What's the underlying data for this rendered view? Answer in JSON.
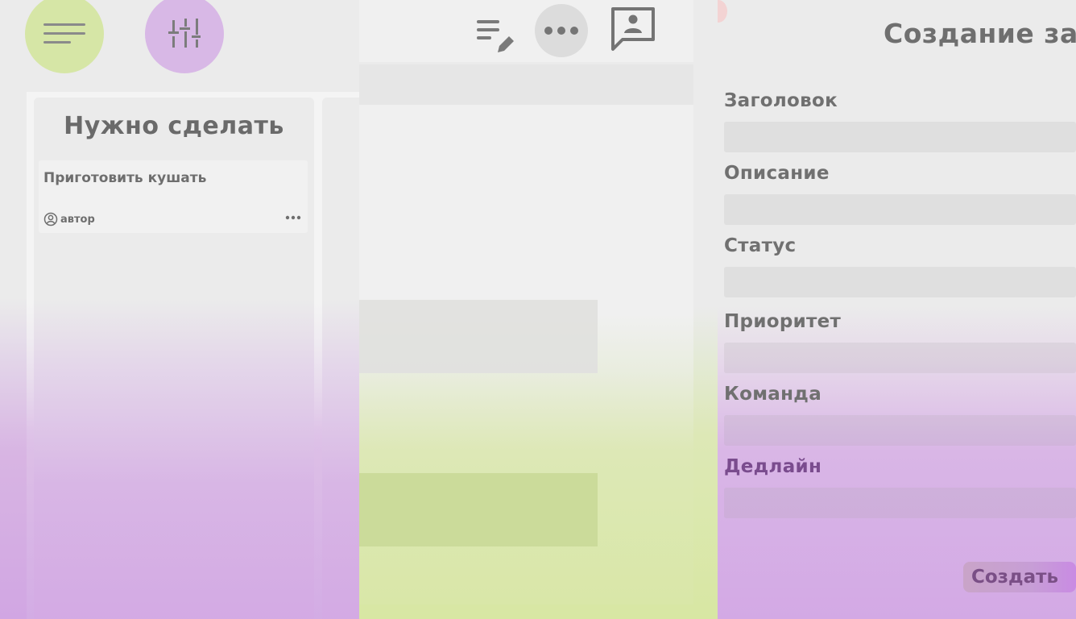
{
  "left": {
    "menu_icon": "hamburger-icon",
    "filter_icon": "sliders-icon",
    "columns": [
      {
        "title": "Нужно сделать",
        "tasks": [
          {
            "title": "Приготовить кушать",
            "author": "автор",
            "author_icon": "user-circle-icon",
            "more_icon": "more-horizontal-icon"
          }
        ]
      }
    ]
  },
  "middle": {
    "icons": [
      "edit-list-icon",
      "more-horizontal-icon",
      "chat-user-icon"
    ]
  },
  "form": {
    "title": "Создание за",
    "fields": [
      {
        "label": "Заголовок"
      },
      {
        "label": "Описание"
      },
      {
        "label": "Статус"
      },
      {
        "label": "Приоритет"
      },
      {
        "label": "Команда"
      },
      {
        "label": "Дедлайн"
      }
    ],
    "submit_label": "Создать"
  },
  "colors": {
    "menu_button": "#d6e6a6",
    "filter_button": "#d8b8e6",
    "accent_purple": "#d3a9e5",
    "accent_green": "#d8e7a3"
  }
}
